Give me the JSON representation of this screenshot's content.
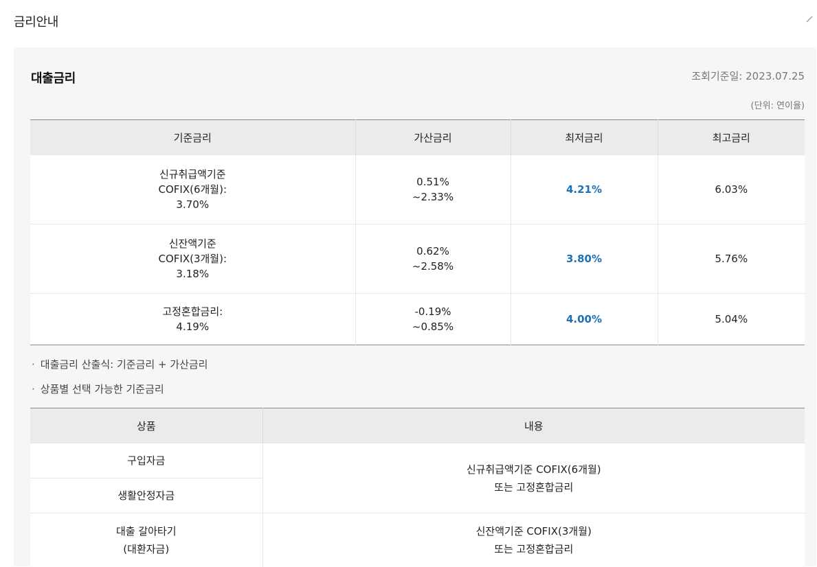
{
  "section": {
    "title": "금리안내",
    "collapse_glyph": "/"
  },
  "panel": {
    "title": "대출금리",
    "query_date": "조회기준일: 2023.07.25",
    "unit": "(단위: 연이율)"
  },
  "rate_table": {
    "headers": [
      "기준금리",
      "가산금리",
      "최저금리",
      "최고금리"
    ],
    "rows": [
      {
        "base": [
          "신규취급액기준",
          "COFIX(6개월):",
          "3.70%"
        ],
        "spread": [
          "0.51%",
          "~2.33%"
        ],
        "min": "4.21%",
        "max": "6.03%"
      },
      {
        "base": [
          "신잔액기준",
          "COFIX(3개월):",
          "3.18%"
        ],
        "spread": [
          "0.62%",
          "~2.58%"
        ],
        "min": "3.80%",
        "max": "5.76%"
      },
      {
        "base": [
          "고정혼합금리:",
          "4.19%"
        ],
        "spread": [
          "-0.19%",
          "~0.85%"
        ],
        "min": "4.00%",
        "max": "5.04%"
      }
    ],
    "min_rate_color": "#1f6fb4"
  },
  "notes": [
    "대출금리 산출식: 기준금리 + 가산금리",
    "상품별 선택 가능한 기준금리"
  ],
  "product_table": {
    "headers": [
      "상품",
      "내용"
    ],
    "rows": [
      {
        "product": "구입자금"
      },
      {
        "product": "생활안정자금"
      },
      {
        "product": [
          "대출 갈아타기",
          "(대환자금)"
        ]
      }
    ],
    "contents": [
      [
        "신규취급액기준 COFIX(6개월)",
        "또는 고정혼합금리"
      ],
      [
        "신잔액기준 COFIX(3개월)",
        "또는 고정혼합금리"
      ]
    ]
  }
}
